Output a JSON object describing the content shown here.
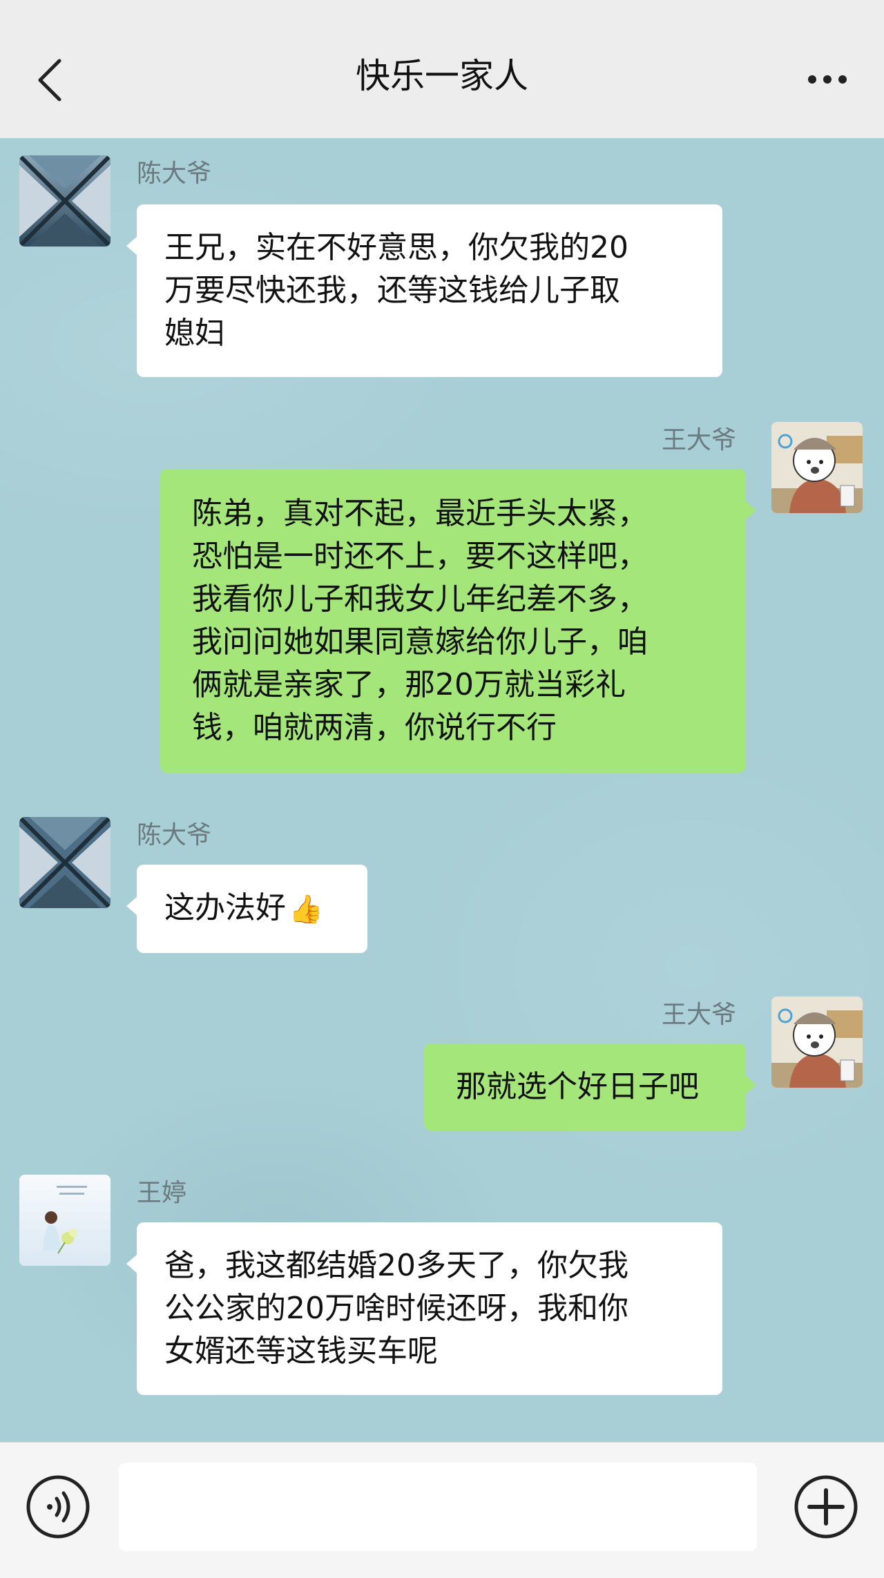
{
  "header": {
    "title": "快乐一家人",
    "back_icon": "chevron-left-icon",
    "more_icon": "more-dots-icon"
  },
  "messages": [
    {
      "sender": "陈大爷",
      "side": "left",
      "avatar": "x-pattern-avatar",
      "lines": [
        "王兄，实在不好意思，你欠我的20",
        "万要尽快还我，还等这钱给儿子取",
        "媳妇"
      ]
    },
    {
      "sender": "王大爷",
      "side": "right",
      "avatar": "cartoon-avatar",
      "lines": [
        "陈弟，真对不起，最近手头太紧，",
        "恐怕是一时还不上，要不这样吧，",
        "我看你儿子和我女儿年纪差不多，",
        "我问问她如果同意嫁给你儿子，咱",
        "俩就是亲家了，那20万就当彩礼",
        "钱，咱就两清，你说行不行"
      ]
    },
    {
      "sender": "陈大爷",
      "side": "left",
      "avatar": "x-pattern-avatar",
      "lines": [
        "这办法好"
      ],
      "emoji": "👍"
    },
    {
      "sender": "王大爷",
      "side": "right",
      "avatar": "cartoon-avatar",
      "lines": [
        "那就选个好日子吧"
      ]
    },
    {
      "sender": "王婷",
      "side": "left",
      "avatar": "girl-flowers-avatar",
      "lines": [
        "爸，我这都结婚20多天了，你欠我",
        "公公家的20万啥时候还呀，我和你",
        "女婿还等这钱买车呢"
      ]
    }
  ],
  "composer": {
    "voice_icon": "voice-icon",
    "input_value": "",
    "plus_icon": "plus-icon"
  },
  "colors": {
    "chat_bg": "#a8ced6",
    "header_bg": "#ededed",
    "bubble_self": "#a5e67a",
    "bubble_other": "#ffffff"
  }
}
